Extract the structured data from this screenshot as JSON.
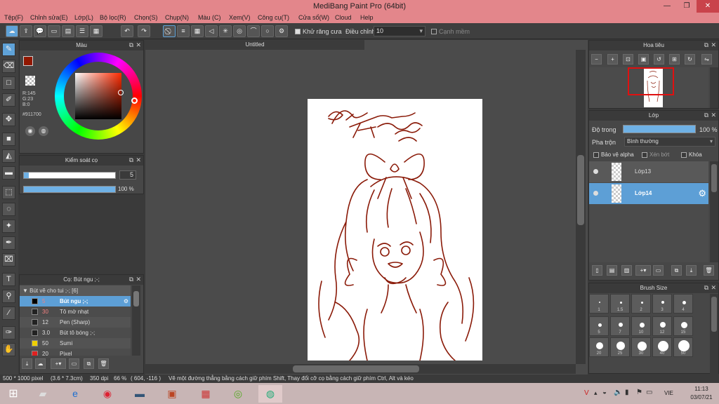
{
  "window": {
    "title": "MediBang Paint Pro (64bit)",
    "minimize": "—",
    "restore": "❐",
    "close": "✕"
  },
  "menu": [
    "Tệp(F)",
    "Chỉnh sửa(E)",
    "Lớp(L)",
    "Bộ lọc(R)",
    "Chọn(S)",
    "Chụp(N)",
    "Màu (C)",
    "Xem(V)",
    "Công cụ(T)",
    "Cửa sổ(W)",
    "Cloud",
    "Help"
  ],
  "toolbar": {
    "antialias_label": "Khử răng cưa",
    "correction_label": "Điều chỉnh",
    "correction_value": "10",
    "soft_edge_label": "Cạnh mềm"
  },
  "color_panel": {
    "title": "Màu",
    "r": "R:145",
    "g": "G:23",
    "b": "B:0",
    "hex": "#911700",
    "primary_color": "#911700",
    "secondary_color": "#c8d8ee"
  },
  "brush_control": {
    "title": "Kiểm soát cọ",
    "size": "5",
    "opacity": "100 %",
    "size_fraction": 0.05,
    "opacity_fraction": 1.0
  },
  "brush_list": {
    "title": "Cọ: Bút ngu ;-;",
    "group": "Bút vẽ cho tui ;-; [6]",
    "items": [
      {
        "size": "5",
        "name": "Bút ngu ;-;",
        "color": "#000000",
        "selected": true
      },
      {
        "size": "30",
        "name": "Tô mờ nhạt",
        "color": "#222222",
        "selected": false
      },
      {
        "size": "12",
        "name": "Pen (Sharp)",
        "color": "#222222",
        "selected": false
      },
      {
        "size": "3.0",
        "name": "Bút tô bóng ;-;",
        "color": "#222222",
        "selected": false
      },
      {
        "size": "50",
        "name": "Sumi",
        "color": "#f0d000",
        "selected": false
      },
      {
        "size": "20",
        "name": "Pixel",
        "color": "#e02020",
        "selected": false
      }
    ]
  },
  "canvas": {
    "tab": "Untitled"
  },
  "navigator": {
    "title": "Hoa tiêu"
  },
  "layers": {
    "title": "Lớp",
    "opacity_label": "Độ trong",
    "opacity_value": "100 %",
    "opacity_fraction": 1.0,
    "blend_label": "Pha trộn",
    "blend_value": "Bình thường",
    "protect_alpha": "Bảo vệ alpha",
    "clipping": "Xén bớt",
    "lock": "Khóa",
    "items": [
      {
        "name": "Lớp13",
        "selected": false
      },
      {
        "name": "Lớp14",
        "selected": true
      }
    ]
  },
  "brush_size": {
    "title": "Brush Size",
    "sizes": [
      "1",
      "1.5",
      "2",
      "3",
      "4",
      "5",
      "7",
      "10",
      "12",
      "15",
      "20",
      "25",
      "30",
      "40",
      "50"
    ]
  },
  "status": {
    "dimensions": "500 * 1000 pixel",
    "physical": "(3.6 * 7.3cm)",
    "dpi": "350 dpi",
    "zoom": "66 %",
    "coords": "( 604, -116 )",
    "hint": "Vẽ một đường thẳng bằng cách giữ phím Shift, Thay đổi cỡ cọ bằng cách giữ phím Ctrl, Alt và kéo"
  },
  "taskbar": {
    "lang": "VIE",
    "time": "11:13",
    "date": "03/07/21"
  }
}
